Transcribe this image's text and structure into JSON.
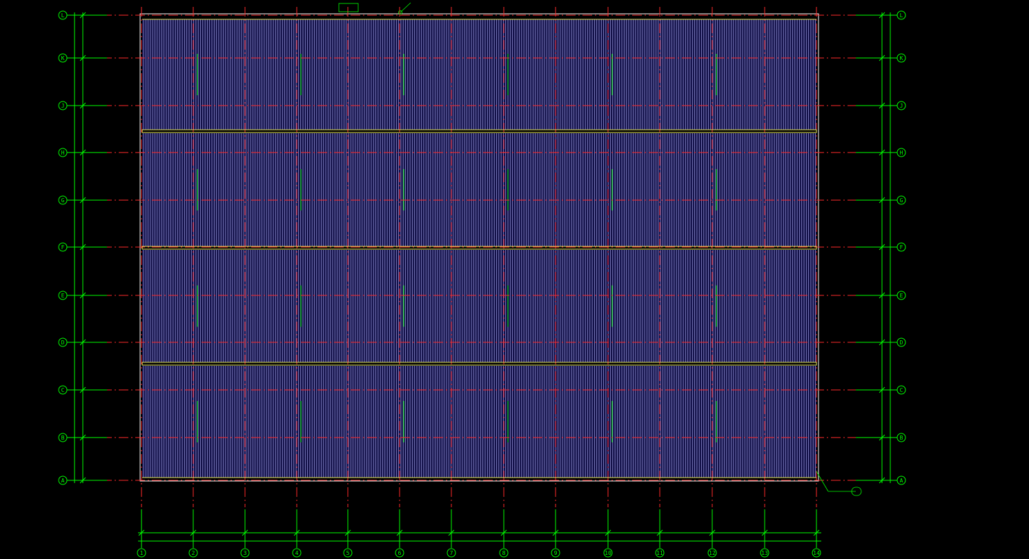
{
  "drawing": {
    "row_axes": [
      "L",
      "K",
      "J",
      "H",
      "G",
      "F",
      "E",
      "D",
      "C",
      "B",
      "A"
    ],
    "col_axes": [
      "1",
      "2",
      "3",
      "4",
      "5",
      "6",
      "7",
      "8",
      "9",
      "10",
      "11",
      "12",
      "13",
      "14"
    ],
    "colors": {
      "background": "#000000",
      "axis_line": "#ff2a2a",
      "dimension": "#00ff00",
      "panel_fill": "#14124a",
      "rib": "#b9b9ff",
      "ridge": "#e8e85a",
      "outline": "#ffffff"
    }
  }
}
